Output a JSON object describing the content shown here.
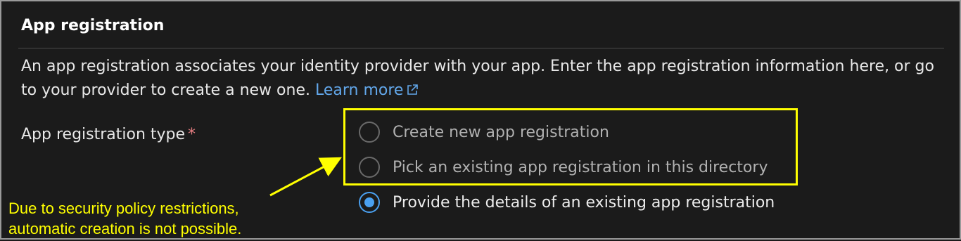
{
  "section": {
    "title": "App registration",
    "description": "An app registration associates your identity provider with your app. Enter the app registration information here, or go to your provider to create a new one.",
    "learn_more_label": "Learn more",
    "learn_more_icon": "external-link-icon"
  },
  "app_registration_type": {
    "label": "App registration type",
    "required_marker": "*",
    "options": [
      {
        "label": "Create new app registration",
        "selected": false,
        "disabled": true
      },
      {
        "label": "Pick an existing app registration in this directory",
        "selected": false,
        "disabled": true
      },
      {
        "label": "Provide the details of an existing app registration",
        "selected": true,
        "disabled": false
      }
    ]
  },
  "annotation": {
    "line1": "Due to security policy restrictions,",
    "line2": "automatic creation is not possible.",
    "color": "#ffff00"
  },
  "colors": {
    "background": "#1b1b1b",
    "accent": "#4aa0f0",
    "link": "#62a7ea",
    "required": "#e37d80",
    "highlight": "#ffff00"
  }
}
